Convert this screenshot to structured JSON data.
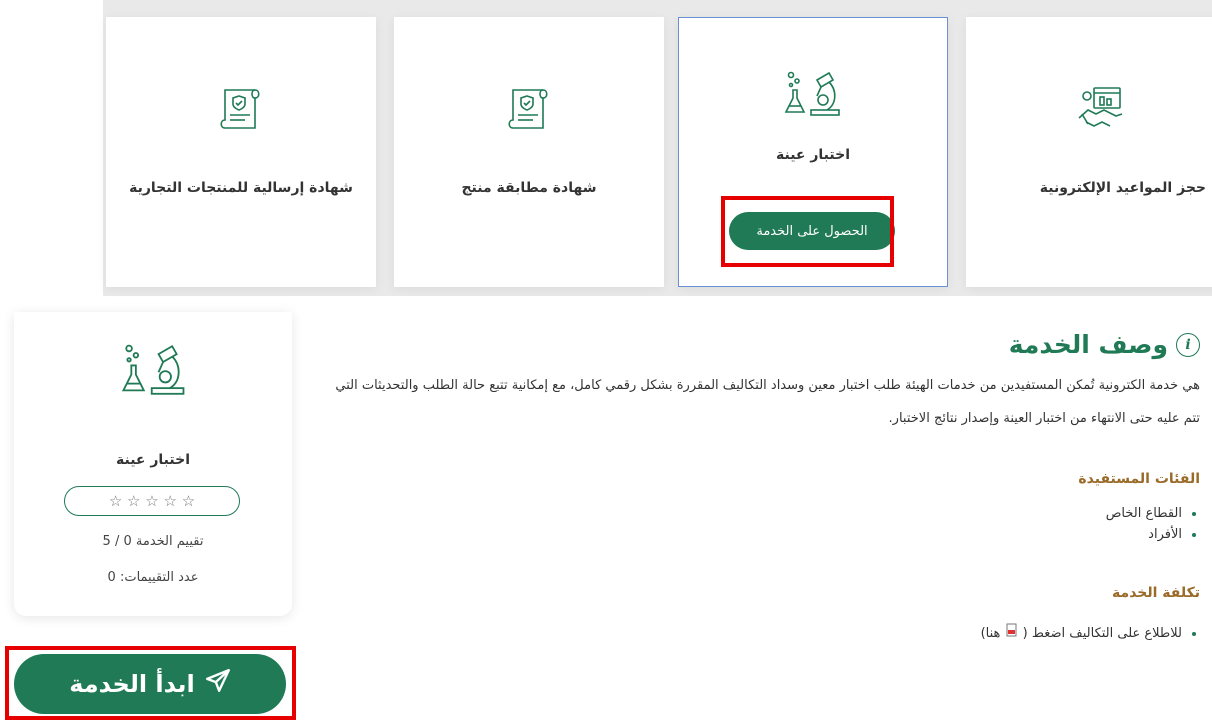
{
  "services": [
    {
      "title": "حجز المواعيد الإلكترونية",
      "icon": "appointment-handshake-icon"
    },
    {
      "title": "اختبار عينة",
      "icon": "lab-microscope-icon",
      "button": "الحصول على الخدمة"
    },
    {
      "title": "شهادة مطابقة منتج",
      "icon": "certificate-scroll-icon"
    },
    {
      "title": "شهادة إرسالية للمنتجات التجارية",
      "icon": "certificate-scroll-icon"
    }
  ],
  "side_card": {
    "name": "اختبار عينة",
    "stars": "☆ ☆ ☆ ☆ ☆",
    "rating_text": "تقييم الخدمة 0 / 5",
    "ratings_count_text": "عدد التقييمات: 0",
    "start_button": "ابدأ الخدمة"
  },
  "description": {
    "heading": "وصف الخدمة",
    "info_glyph": "i",
    "paragraph": "هي خدمة الكترونية تُمكن المستفيدين من خدمات الهيئة طلب اختبار معين وسداد التكاليف المقررة بشكل رقمي كامل، مع إمكانية تتبع حالة الطلب والتحديثات التي تتم عليه حتى الانتهاء من اختبار العينة وإصدار نتائج الاختبار.",
    "beneficiaries_heading": "الفئات المستفيدة",
    "beneficiaries": [
      "القطاع الخاص",
      "الأفراد"
    ],
    "cost_heading": "تكلفة الخدمة",
    "cost_text_before": "للاطلاع على التكاليف اضغط (",
    "cost_link": "هنا",
    "cost_text_after": ")"
  },
  "colors": {
    "brand_green": "#1f7a55",
    "highlight_red": "#e60000",
    "section_brown": "#9a6a28"
  }
}
